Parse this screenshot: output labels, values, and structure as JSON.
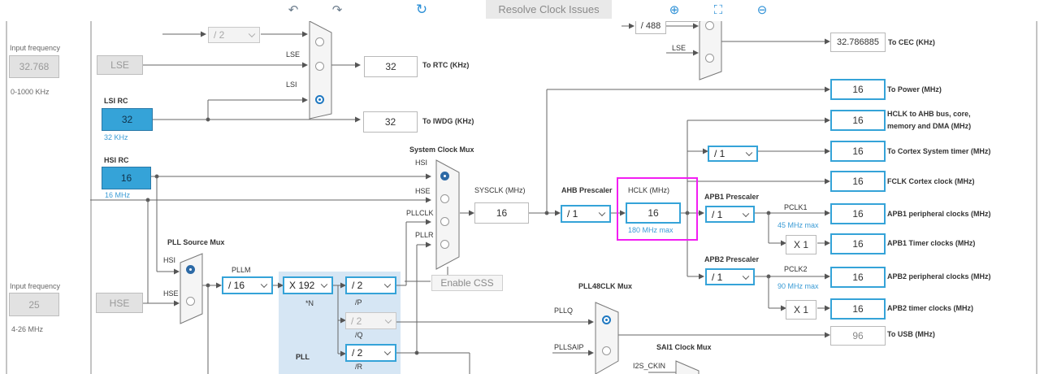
{
  "toolbar": {
    "undo_icon": "↶",
    "redo_icon": "↷",
    "refresh_icon": "↻",
    "resolve_label": "Resolve Clock Issues",
    "zoom_in_icon": "⊕",
    "fit_icon": "⛶",
    "zoom_out_icon": "⊖"
  },
  "left": {
    "input_freq_label_1": "Input frequency",
    "lse_freq": "32.768",
    "lse_range": "0-1000 KHz",
    "lse_label": "LSE",
    "lsi_rc_label": "LSI RC",
    "lsi_value": "32",
    "lsi_unit": "32 KHz",
    "hsi_rc_label": "HSI RC",
    "hsi_value": "16",
    "hsi_unit": "16 MHz",
    "input_freq_label_2": "Input frequency",
    "hse_freq": "25",
    "hse_range": "4-26 MHz",
    "hse_label": "HSE"
  },
  "rtc": {
    "div_value": "/ 2",
    "mux_lse": "LSE",
    "mux_lsi": "LSI",
    "rtc_value": "32",
    "rtc_label": "To RTC (KHz)",
    "iwdg_value": "32",
    "iwdg_label": "To IWDG (KHz)"
  },
  "cec": {
    "div_value": "/ 488",
    "mux_lse": "LSE",
    "cec_value": "32.786885",
    "cec_label": "To CEC (KHz)"
  },
  "sysmux": {
    "title": "System Clock Mux",
    "hsi": "HSI",
    "hse": "HSE",
    "pllclk": "PLLCLK",
    "pllr": "PLLR",
    "sysclk_label": "SYSCLK (MHz)",
    "sysclk_value": "16",
    "enable_css": "Enable CSS"
  },
  "pll": {
    "src_mux_title": "PLL Source Mux",
    "src_hsi": "HSI",
    "src_hse": "HSE",
    "pllm_label": "PLLM",
    "pllm_value": "/ 16",
    "n_value": "X 192",
    "n_label": "*N",
    "p_value": "/ 2",
    "p_label": "/P",
    "q_value": "/ 2",
    "q_label": "/Q",
    "r_value": "/ 2",
    "r_label": "/R",
    "pll_label": "PLL"
  },
  "ahb": {
    "prescaler_label": "AHB Prescaler",
    "prescaler_value": "/ 1",
    "hclk_label": "HCLK (MHz)",
    "hclk_value": "16",
    "hclk_max": "180 MHz max"
  },
  "outputs": {
    "power_value": "16",
    "power_label": "To Power (MHz)",
    "hclk_ahb_value": "16",
    "hclk_ahb_label_1": "HCLK to AHB bus, core,",
    "hclk_ahb_label_2": "memory and DMA (MHz)",
    "cortex_div": "/ 1",
    "cortex_value": "16",
    "cortex_label": "To Cortex System timer (MHz)",
    "fclk_value": "16",
    "fclk_label": "FCLK Cortex clock (MHz)",
    "apb1_prescaler_label": "APB1 Prescaler",
    "apb1_div": "/ 1",
    "pclk1_label": "PCLK1",
    "pclk1_max": "45 MHz max",
    "apb1_periph_value": "16",
    "apb1_periph_label": "APB1 peripheral clocks (MHz)",
    "apb1_timer_mult": "X 1",
    "apb1_timer_value": "16",
    "apb1_timer_label": "APB1 Timer clocks (MHz)",
    "apb2_prescaler_label": "APB2 Prescaler",
    "apb2_div": "/ 1",
    "pclk2_label": "PCLK2",
    "pclk2_max": "90 MHz max",
    "apb2_periph_value": "16",
    "apb2_periph_label": "APB2 peripheral clocks (MHz)",
    "apb2_timer_mult": "X 1",
    "apb2_timer_value": "16",
    "apb2_timer_label": "APB2 timer clocks (MHz)",
    "usb_value": "96",
    "usb_label": "To USB (MHz)"
  },
  "pll48": {
    "title": "PLL48CLK Mux",
    "pllq": "PLLQ",
    "pllsaip": "PLLSAIP",
    "sai1_title": "SAI1 Clock Mux",
    "i2s_ckin": "I2S_CKIN"
  },
  "colors": {
    "accent_blue": "#35a3d8",
    "highlight_magenta": "#f21ef2",
    "pll_area": "#d6e6f4"
  }
}
